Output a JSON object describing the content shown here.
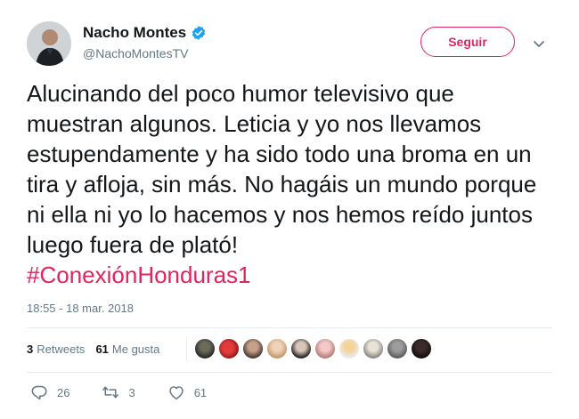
{
  "user": {
    "display_name": "Nacho Montes",
    "handle": "@NachoMontesTV",
    "verified": true
  },
  "follow_button": {
    "label": "Seguir"
  },
  "tweet": {
    "text": "Alucinando del poco humor televisivo que muestran algunos. Leticia y yo nos llevamos estupendamente y ha sido todo una broma en un tira y afloja, sin más. No hagáis un mundo porque ni ella ni yo lo hacemos y nos hemos reído juntos luego fuera de plató!",
    "hashtag": "#ConexiónHonduras1",
    "timestamp": "18:55 - 18 mar. 2018"
  },
  "stats": {
    "retweets_count": "3",
    "retweets_label": "Retweets",
    "likes_count": "61",
    "likes_label": "Me gusta"
  },
  "actions": {
    "replies": "26",
    "retweets": "3",
    "likes": "61"
  },
  "colors": {
    "accent": "#e0245e",
    "verified": "#1da1f2",
    "muted": "#657786",
    "text": "#14171a"
  }
}
